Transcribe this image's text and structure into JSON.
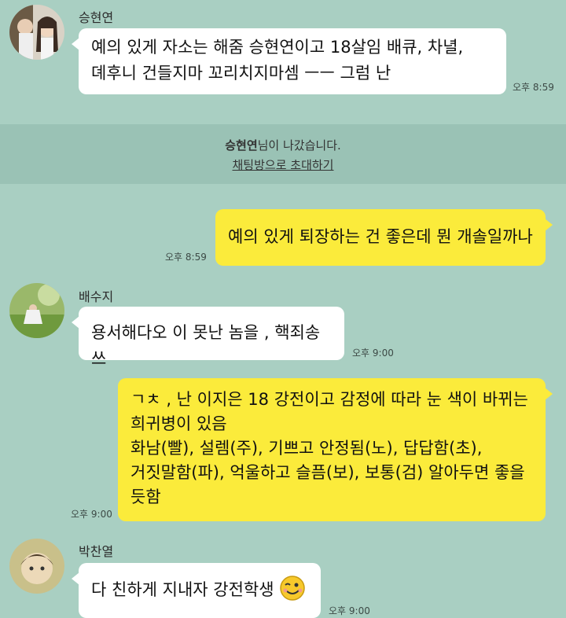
{
  "messages": [
    {
      "sender": "승현연",
      "lines": [
        "예의 있게 자소는 해줌 승현연이고 18살임 배큐, 차녈,",
        "뎨후니 건들지마 꼬리치지마셈 ㅡㅡ 그럼 난"
      ],
      "time": "오후 8:59"
    },
    {
      "mine": true,
      "lines": [
        "예의 있게 퇴장하는 건 좋은데 뭔 개솔일까나"
      ],
      "time": "오후 8:59"
    },
    {
      "sender": "배수지",
      "lines": [
        "용서해다오 이 못난 놈을 , 핵죄송쓰"
      ],
      "time": "오후 9:00"
    },
    {
      "mine": true,
      "lines": [
        "ㄱㅊ , 난 이지은 18 강전이고 감정에 따라 눈 색이 바뀌는",
        "희귀병이 있음",
        "화남(빨), 설렘(주), 기쁘고 안정됨(노), 답답함(초),",
        "거짓말함(파), 억울하고 슬픔(보), 보통(검) 알아두면 좋을",
        "듯함"
      ],
      "time": "오후 9:00"
    },
    {
      "sender": "박찬열",
      "lines": [
        "다 친하게 지내자 강전학생"
      ],
      "time": "오후 9:00",
      "emoji": "wink-emoji"
    }
  ],
  "system": {
    "name": "승현연",
    "left_text": "님이 나갔습니다.",
    "invite_link": "채팅방으로 초대하기"
  },
  "colors": {
    "background": "#a9cfc2",
    "system_bar": "#9ac2b5",
    "my_bubble": "#fbeb3b",
    "their_bubble": "#ffffff"
  }
}
